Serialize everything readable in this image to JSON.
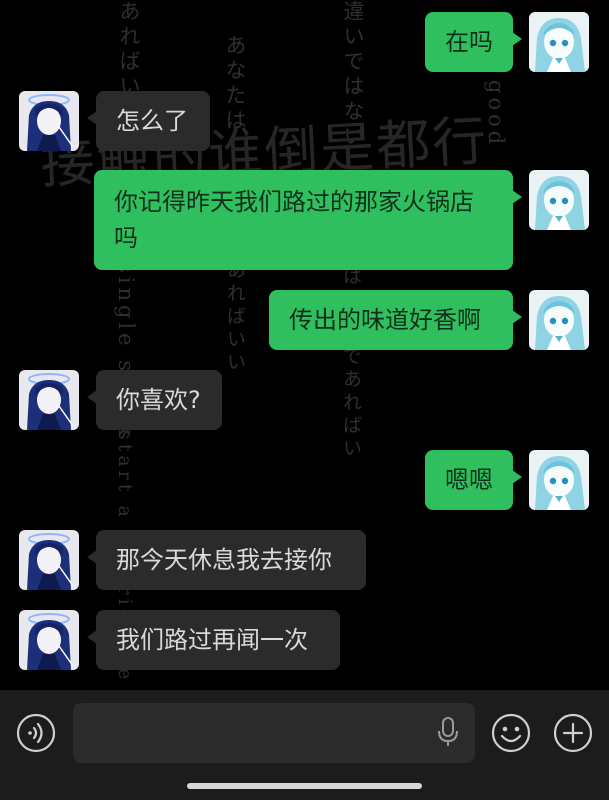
{
  "background": {
    "vertical_texts": [
      "違いではない",
      "あなたは",
      "あればいい",
      "good",
      "single spark",
      "あればいい",
      "は",
      "なたであればい",
      "start a prairie fire"
    ],
    "big_text": "接触的谁倒是都行"
  },
  "messages": [
    {
      "sender": "me",
      "text": "在吗"
    },
    {
      "sender": "other",
      "text": "怎么了"
    },
    {
      "sender": "me",
      "text": "你记得昨天我们路过的那家火锅店吗"
    },
    {
      "sender": "me",
      "text": "传出的味道好香啊"
    },
    {
      "sender": "other",
      "text": "你喜欢?"
    },
    {
      "sender": "me",
      "text": "嗯嗯"
    },
    {
      "sender": "other",
      "text": "那今天休息我去接你"
    },
    {
      "sender": "other",
      "text": "我们路过再闻一次"
    }
  ],
  "input_bar": {
    "voice_icon": "voice-icon",
    "mic_icon": "microphone-icon",
    "emoji_icon": "emoji-icon",
    "add_icon": "plus-circle-icon",
    "message_value": ""
  },
  "colors": {
    "background": "#000000",
    "my_bubble": "#2fbf5f",
    "other_bubble": "#2b2b2b",
    "input_bar": "#1c1c1c"
  }
}
